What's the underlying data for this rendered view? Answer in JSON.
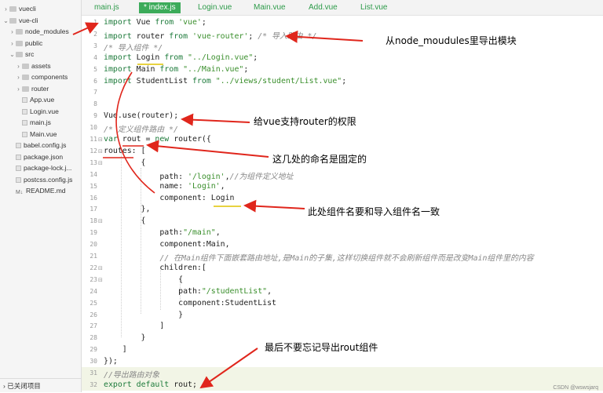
{
  "sidebar": {
    "items": [
      {
        "label": "vuecli",
        "twisty": "›",
        "icon": "folder",
        "depth": 0
      },
      {
        "label": "vue-cli",
        "twisty": "⌄",
        "icon": "folder",
        "depth": 0
      },
      {
        "label": "node_modules",
        "twisty": "›",
        "icon": "folder",
        "depth": 1
      },
      {
        "label": "public",
        "twisty": "›",
        "icon": "folder",
        "depth": 1
      },
      {
        "label": "src",
        "twisty": "⌄",
        "icon": "folder",
        "depth": 1
      },
      {
        "label": "assets",
        "twisty": "›",
        "icon": "folder",
        "depth": 2
      },
      {
        "label": "components",
        "twisty": "›",
        "icon": "folder",
        "depth": 2
      },
      {
        "label": "router",
        "twisty": "›",
        "icon": "folder",
        "depth": 2
      },
      {
        "label": "App.vue",
        "twisty": "",
        "icon": "file",
        "depth": 2
      },
      {
        "label": "Login.vue",
        "twisty": "",
        "icon": "file",
        "depth": 2
      },
      {
        "label": "main.js",
        "twisty": "",
        "icon": "file",
        "depth": 2
      },
      {
        "label": "Main.vue",
        "twisty": "",
        "icon": "file",
        "depth": 2
      },
      {
        "label": "babel.config.js",
        "twisty": "",
        "icon": "file",
        "depth": 1
      },
      {
        "label": "package.json",
        "twisty": "",
        "icon": "file",
        "depth": 1
      },
      {
        "label": "package-lock.j...",
        "twisty": "",
        "icon": "file",
        "depth": 1
      },
      {
        "label": "postcss.config.js",
        "twisty": "",
        "icon": "file",
        "depth": 1
      },
      {
        "label": "README.md",
        "twisty": "",
        "icon": "md",
        "depth": 1
      }
    ],
    "footer": "› 已关闭项目"
  },
  "tabs": [
    {
      "label": "main.js",
      "active": false
    },
    {
      "label": "* index.js",
      "active": true
    },
    {
      "label": "Login.vue",
      "active": false
    },
    {
      "label": "Main.vue",
      "active": false
    },
    {
      "label": "Add.vue",
      "active": false
    },
    {
      "label": "List.vue",
      "active": false
    }
  ],
  "code_lines": [
    {
      "n": "1",
      "fold": "",
      "text": "import Vue from 'vue';"
    },
    {
      "n": "2",
      "fold": "",
      "text": "import router from 'vue-router'; /* 导入路由 */"
    },
    {
      "n": "3",
      "fold": "",
      "text": "/* 导入组件 */"
    },
    {
      "n": "4",
      "fold": "",
      "text": "import Login from \"../Login.vue\";"
    },
    {
      "n": "5",
      "fold": "",
      "text": "import Main from \"../Main.vue\";"
    },
    {
      "n": "6",
      "fold": "",
      "text": "import StudentList from \"../views/student/List.vue\";"
    },
    {
      "n": "7",
      "fold": "",
      "text": ""
    },
    {
      "n": "8",
      "fold": "",
      "text": ""
    },
    {
      "n": "9",
      "fold": "",
      "text": "Vue.use(router);"
    },
    {
      "n": "10",
      "fold": "",
      "text": "/* 定义组件路由 */"
    },
    {
      "n": "11",
      "fold": "⊟",
      "text": "var rout = new router({"
    },
    {
      "n": "12",
      "fold": "⊟",
      "text": "routes: ["
    },
    {
      "n": "13",
      "fold": "⊟",
      "text": "        {"
    },
    {
      "n": "14",
      "fold": "",
      "text": "            path: '/login',//为组件定义地址"
    },
    {
      "n": "15",
      "fold": "",
      "text": "            name: 'Login',"
    },
    {
      "n": "16",
      "fold": "",
      "text": "            component: Login"
    },
    {
      "n": "17",
      "fold": "",
      "text": "        },"
    },
    {
      "n": "18",
      "fold": "⊟",
      "text": "        {"
    },
    {
      "n": "19",
      "fold": "",
      "text": "            path:\"/main\","
    },
    {
      "n": "20",
      "fold": "",
      "text": "            component:Main,"
    },
    {
      "n": "21",
      "fold": "",
      "text": "            // 在Main组件下面嵌套路由地址,是Main的子集,这样切换组件就不会刷新组件而是改变Main组件里的内容"
    },
    {
      "n": "22",
      "fold": "⊟",
      "text": "            children:["
    },
    {
      "n": "23",
      "fold": "⊟",
      "text": "                {"
    },
    {
      "n": "24",
      "fold": "",
      "text": "                path:\"/studentList\","
    },
    {
      "n": "25",
      "fold": "",
      "text": "                component:StudentList"
    },
    {
      "n": "26",
      "fold": "",
      "text": "                }"
    },
    {
      "n": "27",
      "fold": "",
      "text": "            ]"
    },
    {
      "n": "28",
      "fold": "",
      "text": "        }"
    },
    {
      "n": "29",
      "fold": "",
      "text": "    ]"
    },
    {
      "n": "30",
      "fold": "",
      "text": "});"
    },
    {
      "n": "31",
      "fold": "",
      "text": "//导出路由对象"
    },
    {
      "n": "32",
      "fold": "",
      "text": "export default rout;"
    }
  ],
  "annotations": {
    "a1": "从node_moudules里导出模块",
    "a2": "给vue支持router的权限",
    "a3": "这几处的命名是固定的",
    "a4": "此处组件名要和导入组件名一致",
    "a5": "最后不要忘记导出rout组件"
  },
  "watermark": "CSDN @wswsjarq",
  "colors": {
    "keyword": "#1c7a3a",
    "string": "#3a8f2c",
    "comment": "#888888",
    "arrow": "#e0261c",
    "tab_active": "#3cab5a"
  }
}
